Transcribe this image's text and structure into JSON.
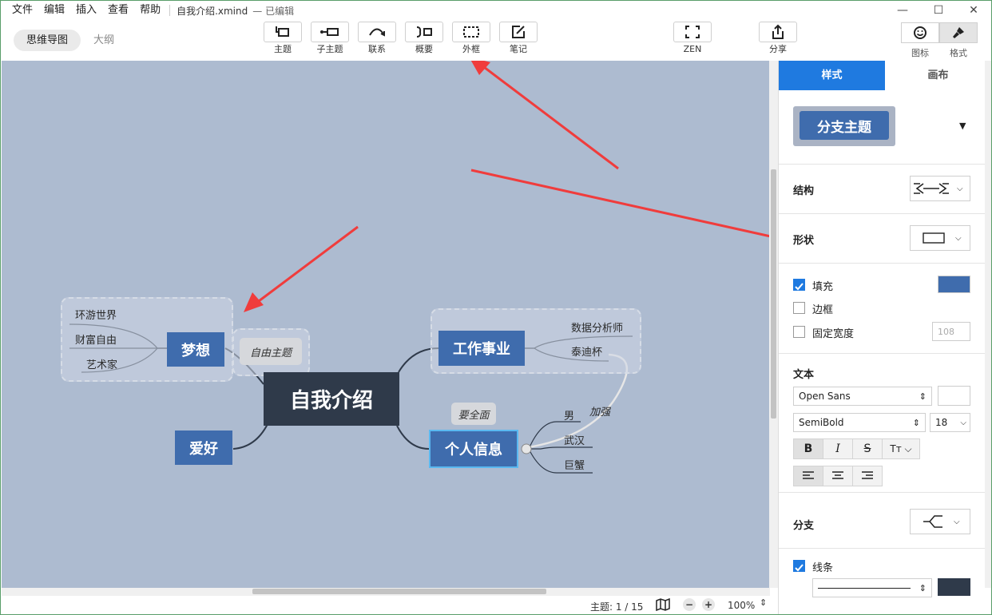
{
  "menu": [
    "文件",
    "编辑",
    "插入",
    "查看",
    "帮助"
  ],
  "document": {
    "title": "自我介绍.xmind",
    "status": "— 已编辑"
  },
  "window_controls": {
    "minimize": "—",
    "maximize": "☐",
    "close": "✕"
  },
  "view_tabs": {
    "mindmap": "思维导图",
    "outline": "大纲"
  },
  "toolbar": {
    "topic": "主题",
    "subtopic": "子主题",
    "relationship": "联系",
    "summary": "概要",
    "boundary": "外框",
    "note": "笔记",
    "zen": "ZEN",
    "share": "分享",
    "icon": "图标",
    "format": "格式"
  },
  "mindmap": {
    "central": "自我介绍",
    "dream": {
      "label": "梦想",
      "children": [
        "环游世界",
        "财富自由",
        "艺术家"
      ]
    },
    "free_topic": "自由主题",
    "hobby": "爱好",
    "career": {
      "label": "工作事业",
      "children": [
        "数据分析师",
        "泰迪杯"
      ]
    },
    "personal": {
      "label": "个人信息",
      "children": [
        "男",
        "武汉",
        "巨蟹"
      ],
      "callout": "要全面"
    },
    "relationship_label": "加强"
  },
  "status": {
    "topic_count": "主题: 1 / 15",
    "zoom": "100%"
  },
  "panel": {
    "tabs": {
      "style": "样式",
      "canvas": "画布"
    },
    "preview_label": "分支主题",
    "structure": "结构",
    "shape": "形状",
    "fill": "填充",
    "border": "边框",
    "fixed_width": "固定宽度",
    "fixed_width_value": "108",
    "text": "文本",
    "font_family": "Open Sans",
    "font_weight": "SemiBold",
    "font_size": "18",
    "branch": "分支",
    "line": "线条",
    "colors": {
      "fill": "#3f6cad",
      "text": "#ffffff",
      "line": "#2f3a4a",
      "accent": "#1f7ae0"
    }
  }
}
